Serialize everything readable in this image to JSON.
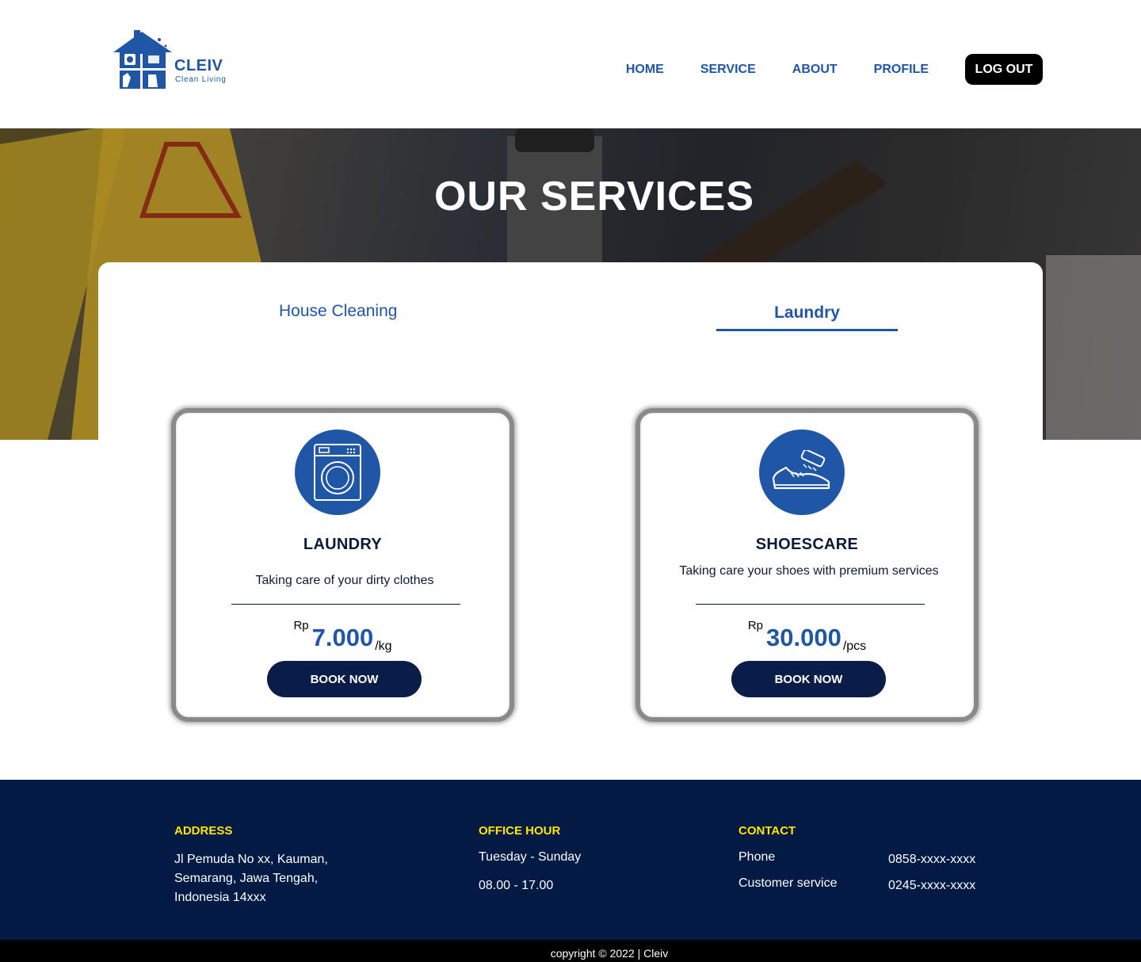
{
  "header": {
    "logo_name": "CLEIV",
    "logo_tagline": "Clean Living",
    "nav": [
      "HOME",
      "SERVICE",
      "ABOUT",
      "PROFILE"
    ],
    "logout_label": "LOG OUT"
  },
  "hero": {
    "title": "OUR SERVICES"
  },
  "tabs": {
    "house": "House Cleaning",
    "laundry": "Laundry",
    "active": "Laundry"
  },
  "cards": [
    {
      "icon": "washing-machine-icon",
      "title": "LAUNDRY",
      "description": "Taking care of your dirty clothes",
      "currency": "Rp",
      "price": "7.000",
      "unit": "/kg",
      "button": "BOOK NOW"
    },
    {
      "icon": "shoe-brush-icon",
      "title": "SHOESCARE",
      "description": "Taking care your shoes with premium services",
      "currency": "Rp",
      "price": "30.000",
      "unit": "/pcs",
      "button": "BOOK NOW"
    }
  ],
  "footer": {
    "address_title": "ADDRESS",
    "address_line1": "Jl Pemuda  No xx, Kauman,",
    "address_line2": "Semarang, Jawa Tengah,",
    "address_line3": "Indonesia 14xxx",
    "office_title": "OFFICE HOUR",
    "office_days": "Tuesday - Sunday",
    "office_time": "08.00 - 17.00",
    "contact_title": "CONTACT",
    "phone_label": "Phone",
    "phone_value": "0858-xxxx-xxxx",
    "cs_label": "Customer service",
    "cs_value": "0245-xxxx-xxxx"
  },
  "copyright": "copyright © 2022 | Cleiv",
  "colors": {
    "brand_blue": "#1f56a6",
    "navy": "#031a45",
    "accent_yellow": "#ffe600"
  }
}
